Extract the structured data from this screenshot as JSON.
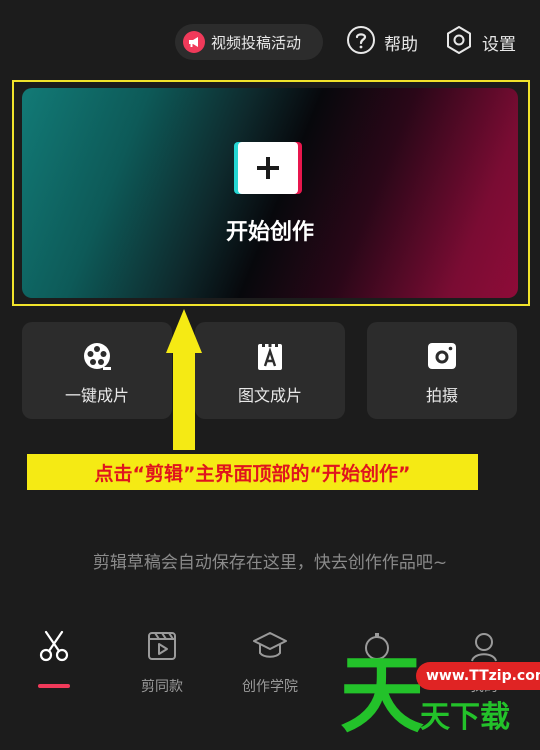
{
  "topbar": {
    "promo_label": "视频投稿活动",
    "help_label": "帮助",
    "settings_label": "设置"
  },
  "hero": {
    "label": "开始创作"
  },
  "cards": [
    {
      "label": "一键成片",
      "icon": "film-reel-icon"
    },
    {
      "label": "图文成片",
      "icon": "text-to-video-icon"
    },
    {
      "label": "拍摄",
      "icon": "camera-icon"
    }
  ],
  "annotation": {
    "text": "点击“剪辑”主界面顶部的“开始创作”"
  },
  "empty_hint": "剪辑草稿会自动保存在这里，快去创作作品吧~",
  "nav": {
    "items": [
      {
        "label": "",
        "icon": "scissors-icon",
        "active": true
      },
      {
        "label": "剪同款",
        "icon": "template-icon"
      },
      {
        "label": "创作学院",
        "icon": "graduation-cap-icon"
      },
      {
        "label": "",
        "icon": "notification-icon"
      },
      {
        "label": "我的",
        "icon": "profile-icon"
      }
    ]
  },
  "watermark": {
    "big": "天",
    "url": "www.TTzip.com",
    "sub": "天下载"
  },
  "colors": {
    "background": "#1c1c1c",
    "card": "#2c2c2c",
    "accent": "#f03a5a",
    "annotation": "#f5ea14",
    "annotation_text": "#e0141e",
    "watermark_green": "#23c22a"
  }
}
